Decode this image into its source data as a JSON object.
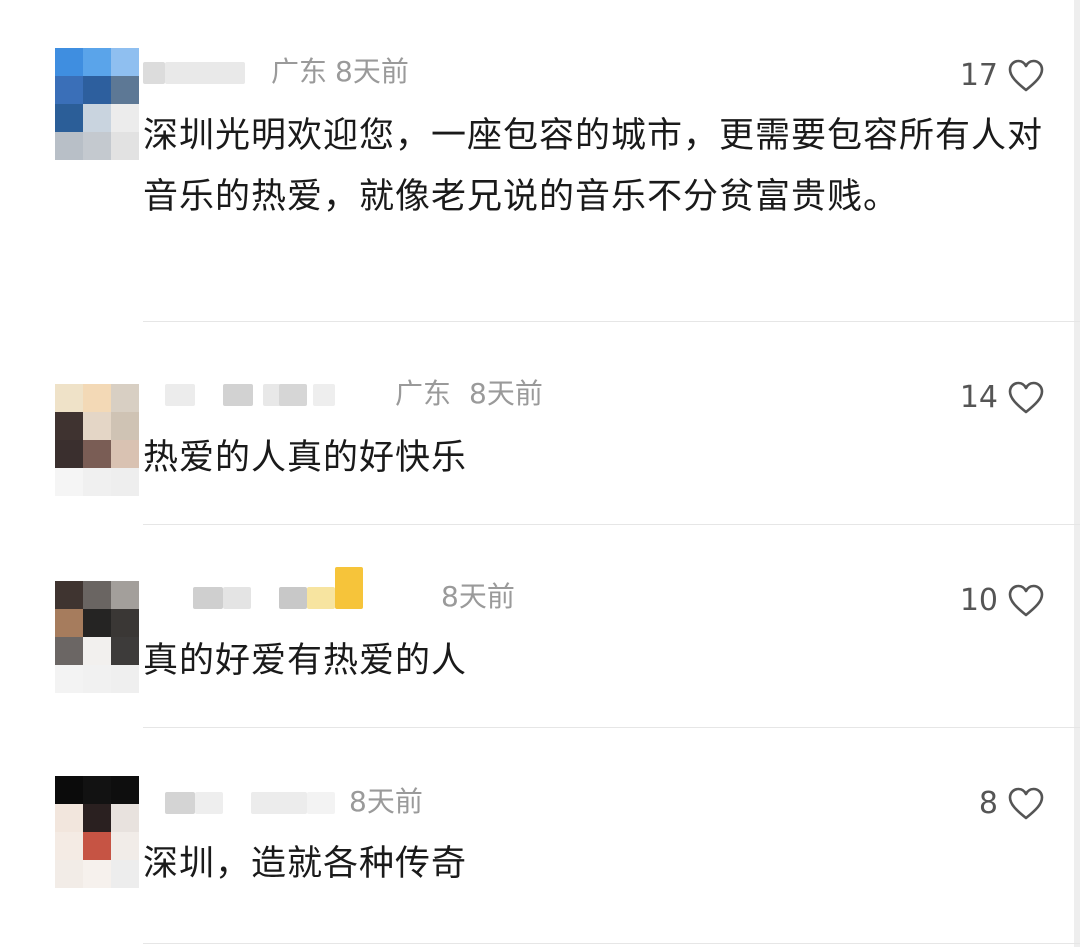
{
  "comments": [
    {
      "location": "广东",
      "time": "8天前",
      "text": "深圳光明欢迎您，一座包容的城市，更需要包容所有人对音乐的热爱，就像老兄说的音乐不分贫富贵贱。",
      "likes": "17",
      "avatar_colors": [
        "#3f8ee0",
        "#5aa4ea",
        "#8fbff0",
        "#3a6fb8",
        "#2d5f9e",
        "#5d7895",
        "#2b5e98",
        "#c9d4df",
        "#ececec",
        "#b8bfc7",
        "#c4c9cf",
        "#e2e2e2"
      ]
    },
    {
      "location": "广东",
      "time": "8天前",
      "text": "热爱的人真的好快乐",
      "likes": "14",
      "avatar_colors": [
        "#efe2c8",
        "#f3d9b6",
        "#d8cfc3",
        "#3f3330",
        "#e4d6c6",
        "#cfc3b4",
        "#3a2f2e",
        "#7a5d55",
        "#d9c2b2",
        "#f5f5f5",
        "#f0f0f0",
        "#eeeeee"
      ]
    },
    {
      "location": "",
      "time": "8天前",
      "text": "真的好爱有热爱的人",
      "likes": "10",
      "avatar_colors": [
        "#3f3430",
        "#6a6562",
        "#a39f9b",
        "#a67c5d",
        "#252423",
        "#3a3735",
        "#6b6664",
        "#f2f0ee",
        "#3d3b3a",
        "#f3f3f3",
        "#f1f1f1",
        "#efefef"
      ]
    },
    {
      "location": "",
      "time": "8天前",
      "text": "深圳，造就各种传奇",
      "likes": "8",
      "avatar_colors": [
        "#0b0b0b",
        "#121212",
        "#0e0e0e",
        "#f2e6dd",
        "#2a2020",
        "#e8e2de",
        "#f4ebe4",
        "#c65444",
        "#f1ece8",
        "#f2ece7",
        "#f6f1ed",
        "#ededed"
      ]
    }
  ]
}
